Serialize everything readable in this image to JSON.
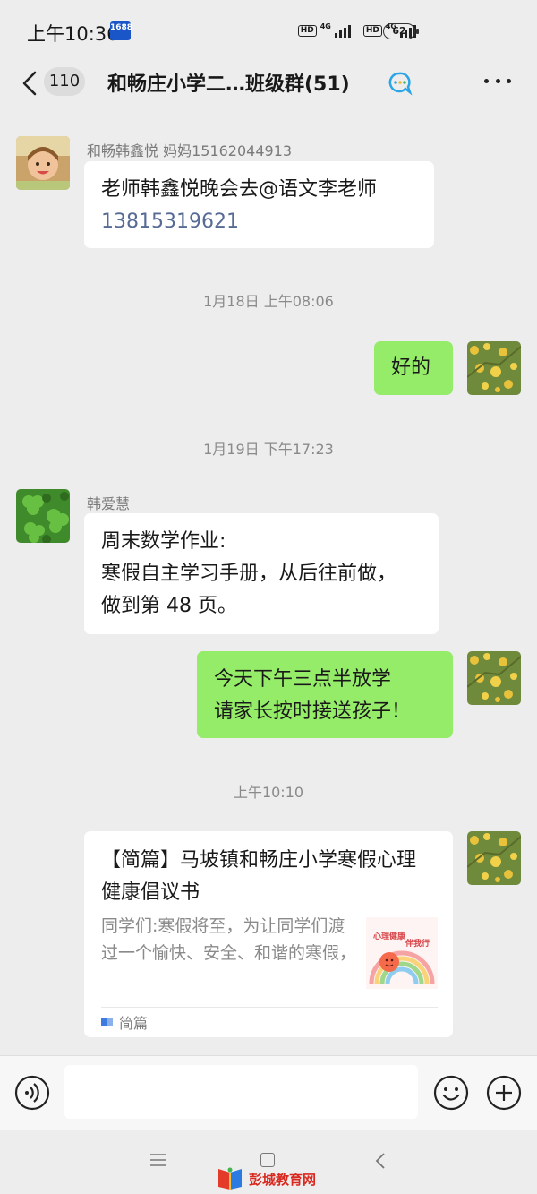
{
  "status_bar": {
    "time": "上午10:36",
    "app_badge": "1688",
    "hd": "HD",
    "network": "4G",
    "battery": "62"
  },
  "header": {
    "unread_count": "110",
    "title": "和畅庄小学二…班级群(51)"
  },
  "messages": {
    "m1": {
      "sender": "和畅韩鑫悦 妈妈15162044913",
      "text": "老师韩鑫悦晚会去@语文李老师",
      "phone": "13815319621"
    },
    "t1": "1月18日 上午08:06",
    "m2": {
      "text": "好的"
    },
    "t2": "1月19日 下午17:23",
    "m3": {
      "sender": "韩爱慧",
      "line1": "周末数学作业:",
      "line2": "寒假自主学习手册，从后往前做，",
      "line3": "做到第 48 页。"
    },
    "m4": {
      "line1": "今天下午三点半放学",
      "line2": "请家长按时接送孩子！"
    },
    "t3": "上午10:10",
    "m5": {
      "card_title": "【简篇】马坡镇和畅庄小学寒假心理健康倡议书",
      "card_desc": "同学们:寒假将至，为让同学们渡过一个愉快、安全、和谐的寒假，",
      "source": "简篇",
      "thumb_text_1": "心理健康",
      "thumb_text_2": "伴我行"
    }
  },
  "input": {
    "placeholder": ""
  },
  "watermark": {
    "text": "彭城教育网"
  },
  "colors": {
    "background": "#ededed",
    "bubble_out": "#95ec69",
    "bubble_in": "#ffffff",
    "link": "#576b95",
    "watermark": "#d9281f"
  }
}
